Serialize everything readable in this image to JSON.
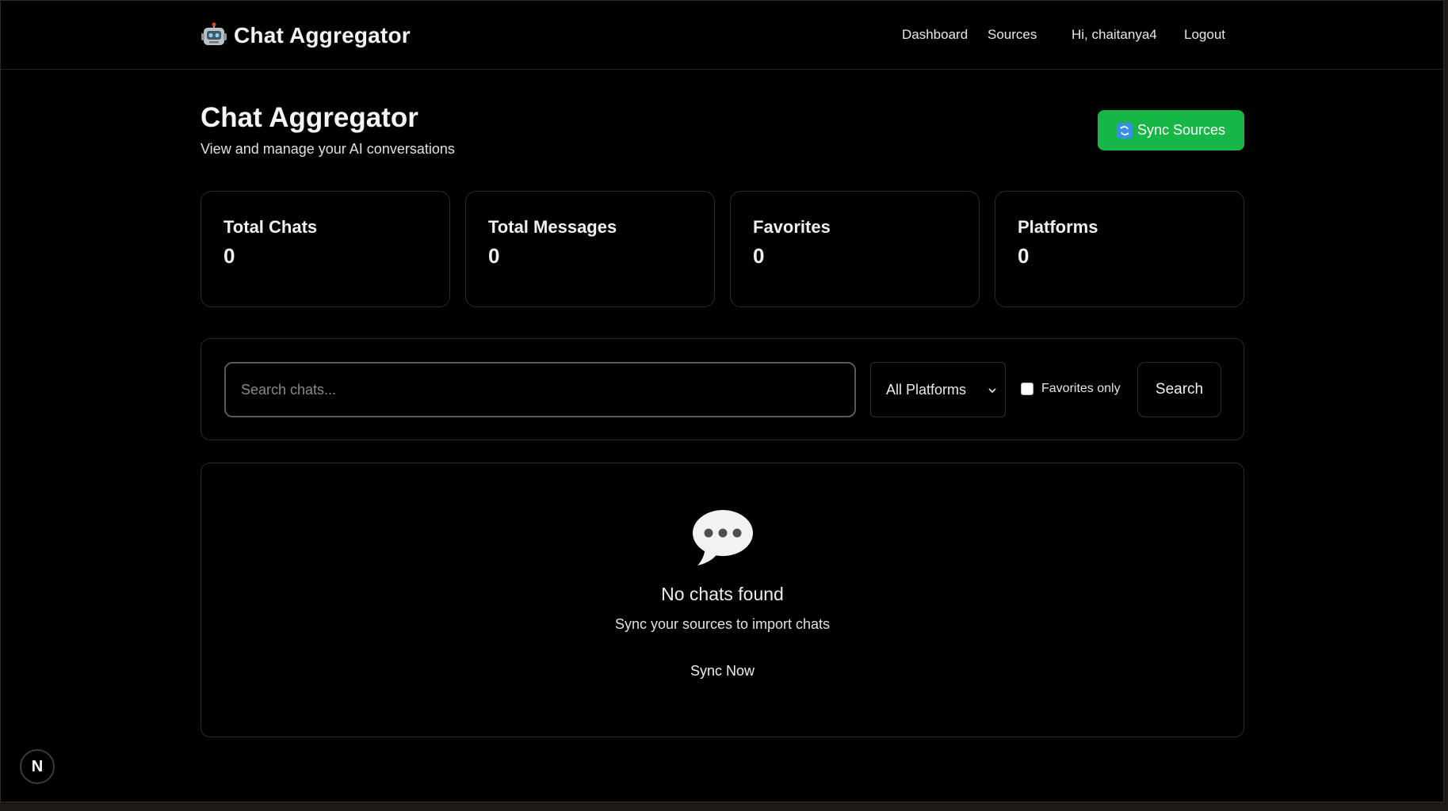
{
  "navbar": {
    "brand_title": "Chat Aggregator",
    "brand_icon": "robot-icon",
    "links": {
      "dashboard": "Dashboard",
      "sources": "Sources",
      "greeting": "Hi, chaitanya4",
      "logout": "Logout"
    }
  },
  "header": {
    "title": "Chat Aggregator",
    "subtitle": "View and manage your AI conversations",
    "sync_button": "Sync Sources",
    "sync_icon": "sync-arrows-icon"
  },
  "stats": [
    {
      "label": "Total Chats",
      "value": "0"
    },
    {
      "label": "Total Messages",
      "value": "0"
    },
    {
      "label": "Favorites",
      "value": "0"
    },
    {
      "label": "Platforms",
      "value": "0"
    }
  ],
  "filters": {
    "search_placeholder": "Search chats...",
    "search_value": "",
    "platform_selected": "All Platforms",
    "favorites_only_label": "Favorites only",
    "favorites_only_checked": false,
    "search_button": "Search"
  },
  "empty_state": {
    "icon": "speech-bubble-icon",
    "title": "No chats found",
    "subtitle": "Sync your sources to import chats",
    "action": "Sync Now"
  },
  "dev_badge": "N",
  "colors": {
    "background": "#000000",
    "accent_green": "#16b746",
    "card_border": "#2a2a2a"
  }
}
